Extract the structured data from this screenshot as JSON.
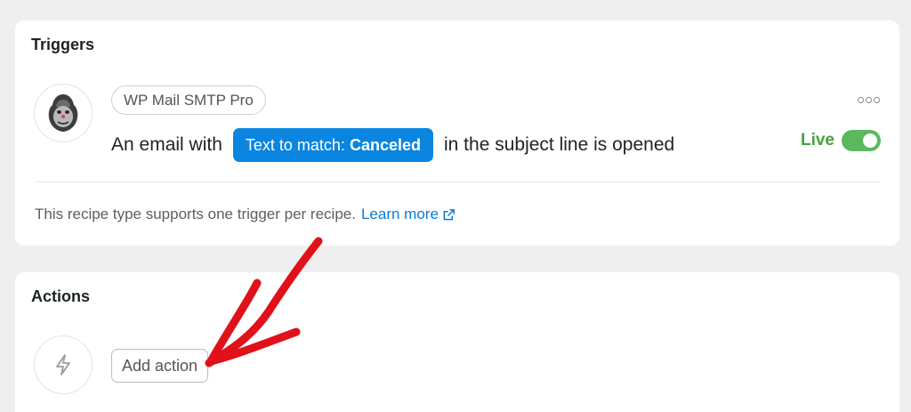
{
  "triggers": {
    "title": "Triggers",
    "integration": "WP Mail SMTP Pro",
    "integration_icon": "gorilla-logo",
    "sentence": {
      "before": "An email with",
      "token_label": "Text to match:",
      "token_value": "Canceled",
      "after": "in the subject line is opened"
    },
    "status": "Live",
    "status_enabled": true,
    "note": "This recipe type supports one trigger per recipe.",
    "learn_more": "Learn more"
  },
  "actions": {
    "title": "Actions",
    "icon": "bolt-icon",
    "add_label": "Add action"
  },
  "colors": {
    "accent": "#0a85e0",
    "live": "#47a33c",
    "toggle": "#5cb85c",
    "annotation_arrow": "#e0111a"
  }
}
